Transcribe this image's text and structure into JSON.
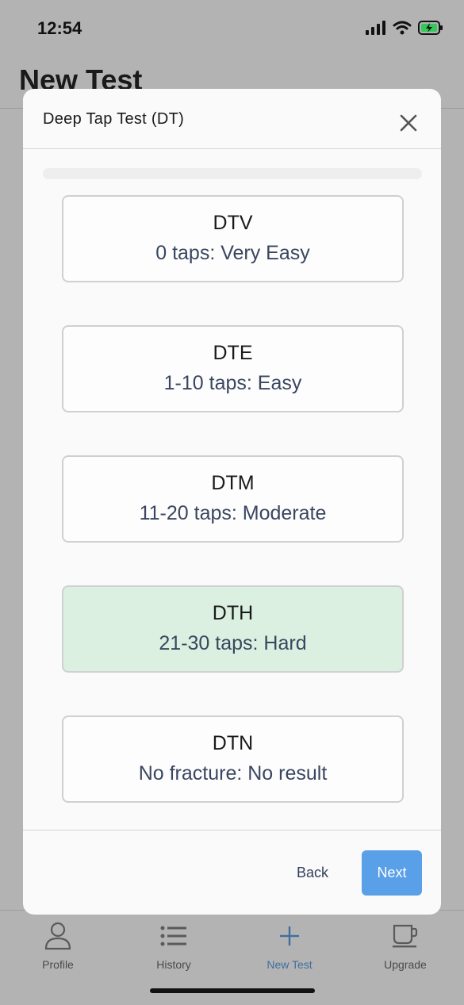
{
  "status": {
    "time": "12:54"
  },
  "background": {
    "page_title": "New Test"
  },
  "modal": {
    "title": "Deep Tap Test (DT)",
    "progress": 0,
    "options": [
      {
        "code": "DTV",
        "description": "0 taps: Very Easy",
        "selected": false
      },
      {
        "code": "DTE",
        "description": "1-10 taps: Easy",
        "selected": false
      },
      {
        "code": "DTM",
        "description": "11-20 taps: Moderate",
        "selected": false
      },
      {
        "code": "DTH",
        "description": "21-30 taps: Hard",
        "selected": true
      },
      {
        "code": "DTN",
        "description": "No fracture: No result",
        "selected": false
      }
    ],
    "back_label": "Back",
    "next_label": "Next"
  },
  "tabs": [
    {
      "label": "Profile",
      "icon": "person-icon",
      "active": false
    },
    {
      "label": "History",
      "icon": "list-icon",
      "active": false
    },
    {
      "label": "New Test",
      "icon": "plus-icon",
      "active": true
    },
    {
      "label": "Upgrade",
      "icon": "coffee-cup-icon",
      "active": false
    }
  ],
  "colors": {
    "accent": "#5aa0e8",
    "selected_bg": "#dbf0e0",
    "active_tab": "#3f6f9e"
  }
}
